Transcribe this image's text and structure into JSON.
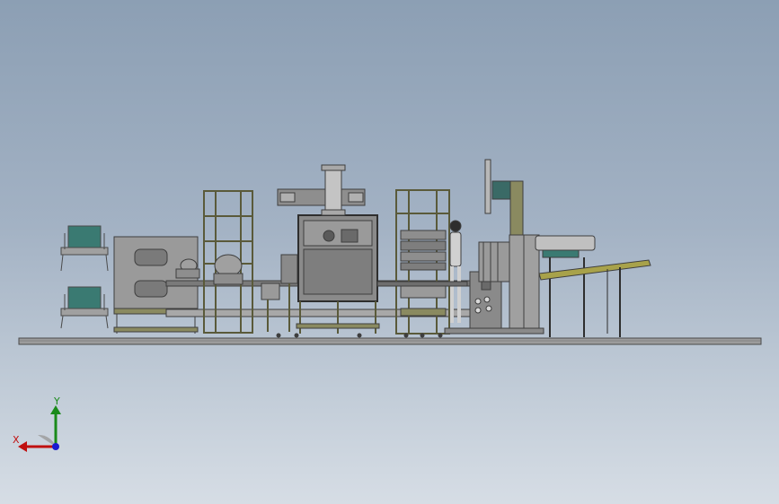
{
  "viewport": {
    "background_top": "#8c9fb4",
    "background_bottom": "#d6dde5"
  },
  "model": {
    "colors": {
      "frame": "#8a8a60",
      "frame_dark": "#5a5a3a",
      "panel": "#9a9a9a",
      "panel_dark": "#6e6e6e",
      "base_plate": "#8e8e8e",
      "teal": "#3a7a72",
      "conveyor_yellow": "#a8a24a",
      "hopper": "#b8b8b8"
    }
  },
  "triad": {
    "x_label": "X",
    "y_label": "Y",
    "x_color": "#c01010",
    "y_color": "#1a8a1a",
    "z_color": "#1a1ad0",
    "icon": "coordinate-axes-icon"
  }
}
